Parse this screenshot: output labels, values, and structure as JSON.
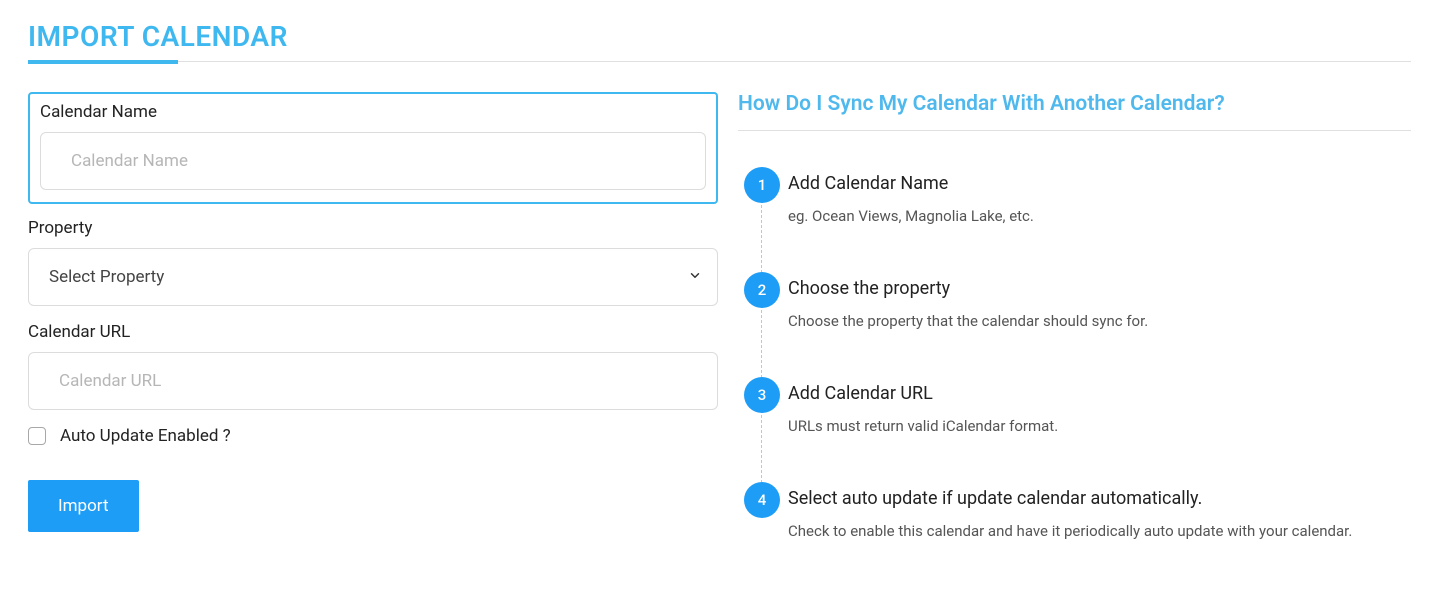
{
  "title": "IMPORT CALENDAR",
  "form": {
    "calendarName": {
      "label": "Calendar Name",
      "placeholder": "Calendar Name",
      "value": ""
    },
    "property": {
      "label": "Property",
      "placeholder": "Select Property",
      "value": ""
    },
    "calendarUrl": {
      "label": "Calendar URL",
      "placeholder": "Calendar URL",
      "value": ""
    },
    "autoUpdate": {
      "label": "Auto Update Enabled ?",
      "checked": false
    },
    "submitLabel": "Import"
  },
  "help": {
    "title": "How Do I Sync My Calendar With Another Calendar?",
    "steps": [
      {
        "num": "1",
        "title": "Add Calendar Name",
        "desc": "eg. Ocean Views, Magnolia Lake, etc."
      },
      {
        "num": "2",
        "title": "Choose the property",
        "desc": "Choose the property that the calendar should sync for."
      },
      {
        "num": "3",
        "title": "Add Calendar URL",
        "desc": "URLs must return valid iCalendar format."
      },
      {
        "num": "4",
        "title": "Select auto update if update calendar automatically.",
        "desc": "Check to enable this calendar and have it periodically auto update with your calendar."
      }
    ]
  }
}
